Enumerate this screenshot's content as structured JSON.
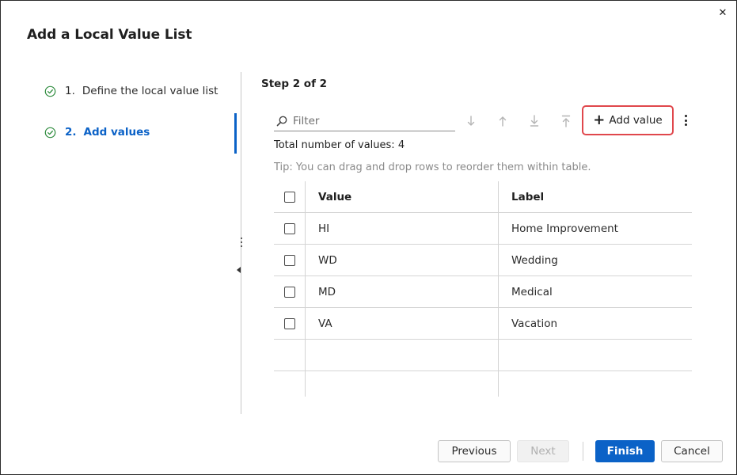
{
  "dialog": {
    "title": "Add a Local Value List",
    "close_icon": "close-icon"
  },
  "steps": [
    {
      "number": "1.",
      "label": "Define the local value list",
      "status": "complete",
      "active": false
    },
    {
      "number": "2.",
      "label": "Add values",
      "status": "complete",
      "active": true
    }
  ],
  "main": {
    "step_heading": "Step 2 of 2",
    "filter": {
      "placeholder": "Filter",
      "value": ""
    },
    "toolbar": {
      "move_down_icon": "arrow-down-icon",
      "move_up_icon": "arrow-up-icon",
      "move_bottom_icon": "arrow-to-bottom-icon",
      "move_top_icon": "arrow-to-top-icon",
      "add_value_label": "Add value",
      "more_icon": "more-vertical-icon"
    },
    "total_text": "Total number of values: 4",
    "tip_text": "Tip: You can drag and drop rows to reorder them within table.",
    "table": {
      "columns": [
        "Value",
        "Label"
      ],
      "rows": [
        {
          "value": "HI",
          "label": "Home Improvement"
        },
        {
          "value": "WD",
          "label": "Wedding"
        },
        {
          "value": "MD",
          "label": "Medical"
        },
        {
          "value": "VA",
          "label": "Vacation"
        }
      ]
    }
  },
  "footer": {
    "previous_label": "Previous",
    "next_label": "Next",
    "finish_label": "Finish",
    "cancel_label": "Cancel"
  },
  "colors": {
    "accent": "#0b62c7",
    "highlight_border": "#e0474c",
    "check_green": "#2e8b3d"
  }
}
